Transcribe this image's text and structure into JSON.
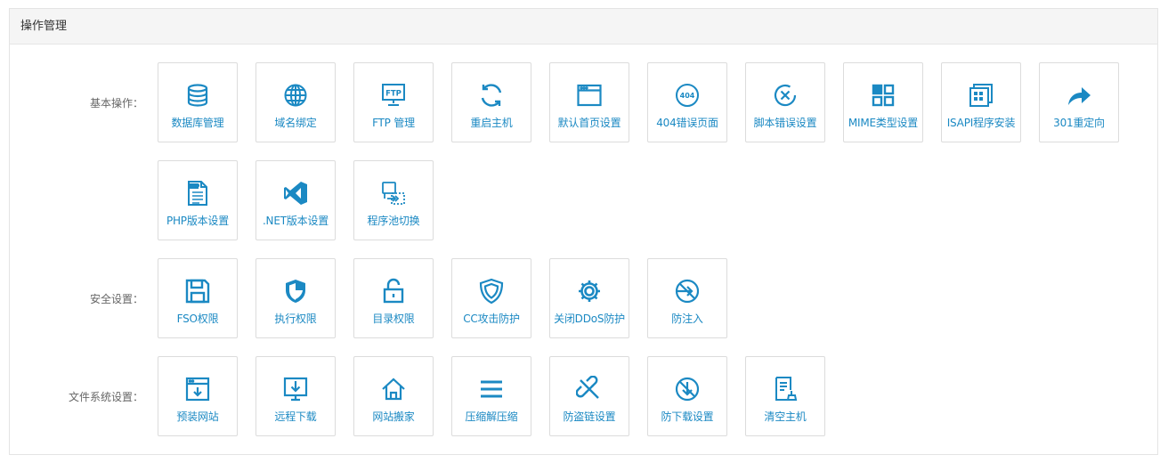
{
  "colors": {
    "accent": "#1b89c3",
    "label": "#666666",
    "border": "#dcdcdc"
  },
  "panel": {
    "title": "操作管理"
  },
  "sections": [
    {
      "label": "基本操作：",
      "items": [
        {
          "label": "数据库管理",
          "icon": "database-icon"
        },
        {
          "label": "域名绑定",
          "icon": "globe-icon"
        },
        {
          "label": "FTP 管理",
          "icon": "ftp-icon"
        },
        {
          "label": "重启主机",
          "icon": "restart-icon"
        },
        {
          "label": "默认首页设置",
          "icon": "browser-window-icon"
        },
        {
          "label": "404错误页面",
          "icon": "error-404-icon"
        },
        {
          "label": "脚本错误设置",
          "icon": "script-error-icon"
        },
        {
          "label": "MIME类型设置",
          "icon": "grid-apps-icon"
        },
        {
          "label": "ISAPI程序安装",
          "icon": "stacked-windows-icon"
        },
        {
          "label": "301重定向",
          "icon": "redirect-arrow-icon"
        },
        {
          "label": "PHP版本设置",
          "icon": "php-file-icon"
        },
        {
          "label": ".NET版本设置",
          "icon": "visual-studio-icon"
        },
        {
          "label": "程序池切换",
          "icon": "pool-switch-icon"
        }
      ]
    },
    {
      "label": "安全设置：",
      "items": [
        {
          "label": "FSO权限",
          "icon": "save-disk-icon"
        },
        {
          "label": "执行权限",
          "icon": "shield-icon"
        },
        {
          "label": "目录权限",
          "icon": "unlock-icon"
        },
        {
          "label": "CC攻击防护",
          "icon": "badge-shield-icon"
        },
        {
          "label": "关闭DDoS防护",
          "icon": "gear-icon"
        },
        {
          "label": "防注入",
          "icon": "no-injection-icon"
        }
      ]
    },
    {
      "label": "文件系统设置：",
      "items": [
        {
          "label": "预装网站",
          "icon": "preinstall-icon"
        },
        {
          "label": "远程下载",
          "icon": "remote-download-icon"
        },
        {
          "label": "网站搬家",
          "icon": "home-icon"
        },
        {
          "label": "压缩解压缩",
          "icon": "menu-lines-icon"
        },
        {
          "label": "防盗链设置",
          "icon": "broken-link-icon"
        },
        {
          "label": "防下载设置",
          "icon": "no-download-icon"
        },
        {
          "label": "清空主机",
          "icon": "clear-host-icon"
        }
      ]
    }
  ]
}
